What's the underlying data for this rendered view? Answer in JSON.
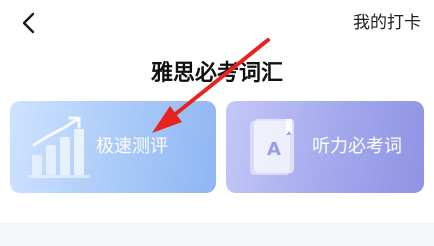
{
  "header": {
    "back_icon": "chevron-left-icon",
    "checkin_label": "我的打卡"
  },
  "page": {
    "title": "雅思必考词汇"
  },
  "cards": [
    {
      "label": "极速测评",
      "icon": "bar-chart-growth-icon",
      "color": "#a9c9f8"
    },
    {
      "label": "听力必考词",
      "icon": "vocabulary-book-icon",
      "color": "#a3a8ec"
    }
  ],
  "annotation": {
    "arrow_color": "#e8231f"
  }
}
